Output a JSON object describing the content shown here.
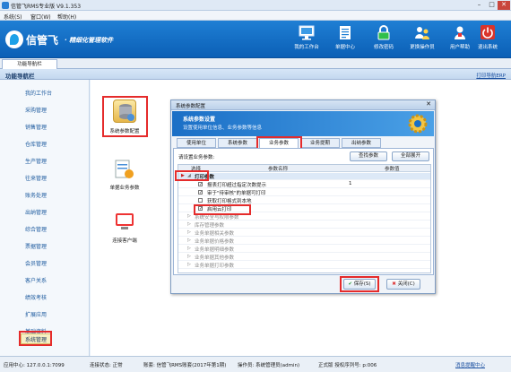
{
  "window": {
    "title": "信管飞RMS专业版 V9.1.353",
    "min": "–",
    "max": "□",
    "close": "✕"
  },
  "menu": [
    "系统(S)",
    "窗口(W)",
    "帮助(H)"
  ],
  "banner": {
    "brand": "信管飞",
    "slogan": "· 精细化管理软件",
    "buttons": [
      {
        "label": "我的工作台",
        "icon": "monitor-icon"
      },
      {
        "label": "单据中心",
        "icon": "documents-icon"
      },
      {
        "label": "修改密码",
        "icon": "lock-icon"
      },
      {
        "label": "更换操作员",
        "icon": "user-switch-icon"
      },
      {
        "label": "用户帮助",
        "icon": "help-user-icon"
      },
      {
        "label": "退出系统",
        "icon": "power-icon"
      }
    ]
  },
  "tab": "功能导航栏",
  "nav_header": {
    "title": "功能导航栏",
    "right_link": "打印导航ERP"
  },
  "sidebar": {
    "items": [
      "我的工作台",
      "采购管理",
      "销售管理",
      "仓库管理",
      "生产管理",
      "往来管理",
      "账务处理",
      "出纳管理",
      "综合管理",
      "票据管理",
      "会员管理",
      "客户关系",
      "绩效考核",
      "扩展应用",
      "基础资料",
      "系统管理"
    ],
    "active": "系统管理"
  },
  "content_icons": [
    {
      "label": "系统参数配置",
      "icon": "database-config-icon"
    },
    {
      "label": "单据业务参数",
      "icon": "document-params-icon"
    },
    {
      "label": "连接客户端",
      "icon": "client-connect-icon"
    }
  ],
  "dialog": {
    "title": "系统参数配置",
    "close": "✕",
    "header_title": "系统参数设置",
    "header_sub": "设置使用单位信息、业务参数等信息",
    "tabs": [
      "使用单位",
      "系统参数",
      "业务参数",
      "业务提期",
      "出纳参数"
    ],
    "active_tab": "业务参数",
    "hint": "请设置业务参数:",
    "find_btn": "查找参数",
    "expand_btn": "全部展开",
    "columns": [
      "选择",
      "参数名称",
      "参数值"
    ],
    "rows": [
      {
        "text": "打印参数",
        "kind": "group-open"
      },
      {
        "text": "报表打印超过指定次数提示",
        "kind": "check",
        "checked": true,
        "value": "1"
      },
      {
        "text": "审于\"待审核\"的单据可打印",
        "kind": "check",
        "checked": true,
        "value": ""
      },
      {
        "text": "获取打印格式到本地",
        "kind": "check",
        "checked": false,
        "value": ""
      },
      {
        "text": "启用云打印",
        "kind": "check",
        "checked": true,
        "value": ""
      },
      {
        "text": "系统安全与权限参数",
        "kind": "group"
      },
      {
        "text": "库存管理参数",
        "kind": "group"
      },
      {
        "text": "业务单据相关参数",
        "kind": "group"
      },
      {
        "text": "业务单据价格参数",
        "kind": "group"
      },
      {
        "text": "业务单据明细参数",
        "kind": "group"
      },
      {
        "text": "业务单据其他参数",
        "kind": "group"
      },
      {
        "text": "业务单据打印参数",
        "kind": "group"
      }
    ],
    "save_btn": "保存(S)",
    "close_btn": "关闭(C)"
  },
  "status": {
    "app_center": "应用中心: 127.0.0.1:7099",
    "conn": "连接状态: 正常",
    "account": "账套: 信管飞RMS账套(2017年第1期)",
    "operator": "操作员: 系统管理员(admin)",
    "license": "正式版 授权序列号: p:006",
    "msg": "消息提醒中心"
  },
  "colors": {
    "accent_red": "#e52b2b",
    "banner_blue": "#1f7fd4",
    "nav_text": "#1c5a9e"
  }
}
